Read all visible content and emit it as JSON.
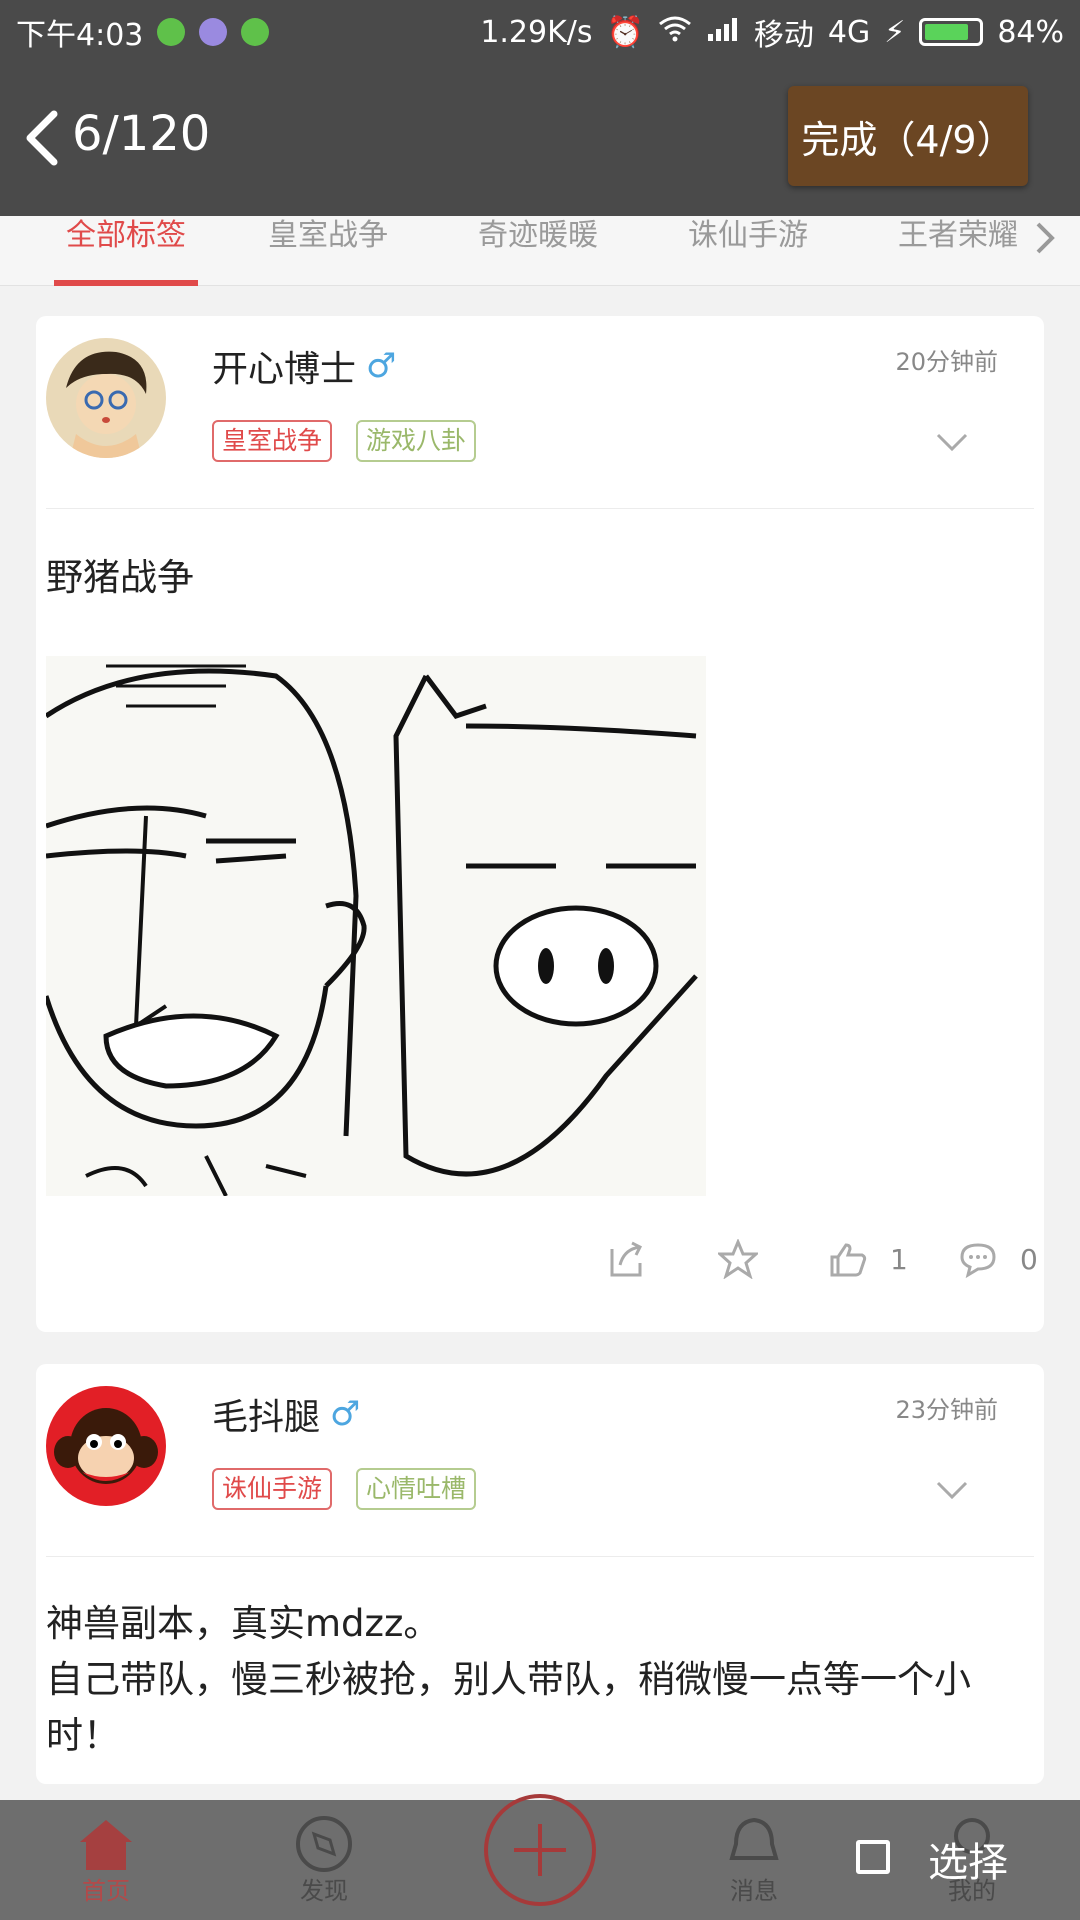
{
  "status_bar": {
    "time": "下午4:03",
    "speed": "1.29K/s",
    "carrier": "移动",
    "network": "4G",
    "battery": "84%",
    "battery_level": 0.84
  },
  "header": {
    "page_counter": "6/120",
    "done_button": "完成（4/9）"
  },
  "tabs": {
    "items": [
      "全部标签",
      "皇室战争",
      "奇迹暖暖",
      "诛仙手游",
      "王者荣耀"
    ],
    "active": "全部标签"
  },
  "posts": [
    {
      "username": "开心博士",
      "gender_icon": "♂",
      "time": "20分钟前",
      "tags": [
        "皇室战争",
        "游戏八卦"
      ],
      "text": "野猪战争",
      "likes": "1",
      "comments": "0"
    },
    {
      "username": "毛抖腿",
      "gender_icon": "♂",
      "time": "23分钟前",
      "tags": [
        "诛仙手游",
        "心情吐槽"
      ],
      "text_lines": [
        "神兽副本，真实mdzz。",
        "自己带队，慢三秒被抢，别人带队，稍微慢一点等一个小",
        "时！"
      ]
    }
  ],
  "bottom_nav": {
    "items": [
      "首页",
      "发现",
      "消息",
      "我的"
    ],
    "active": "首页"
  },
  "select_overlay": {
    "label": "选择"
  },
  "colors": {
    "header_bg": "#4a4a4a",
    "done_button_bg": "#6b4623",
    "accent_red": "#e04a4a",
    "tag_green": "#9ab86a"
  }
}
